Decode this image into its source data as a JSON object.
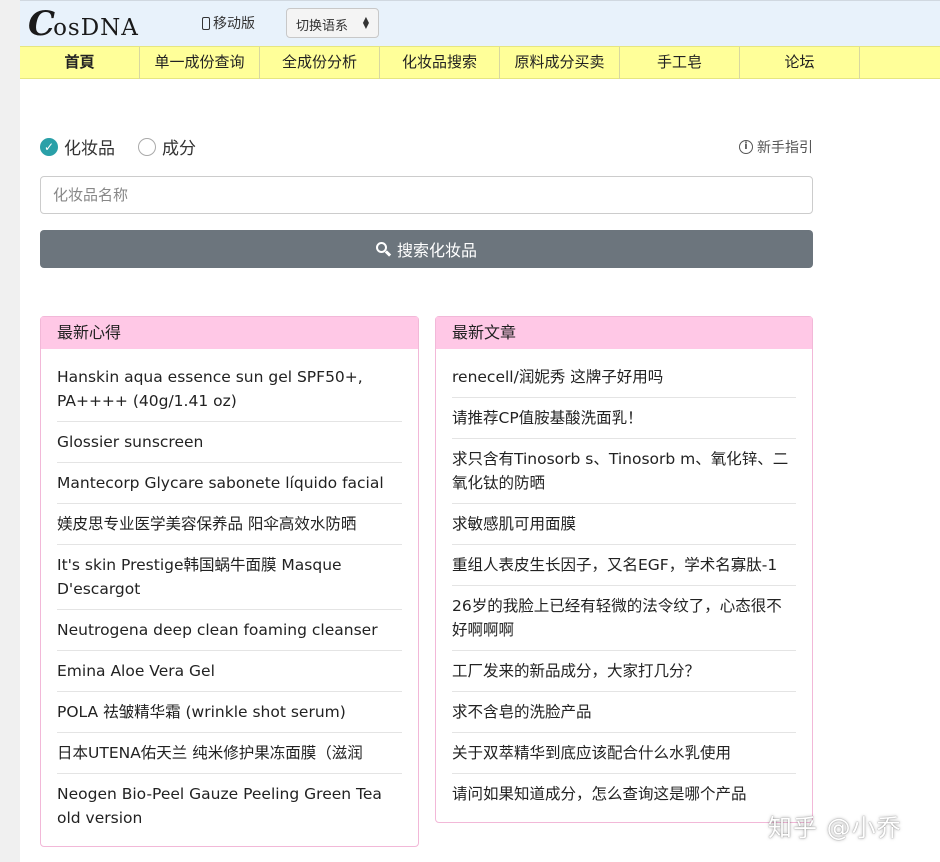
{
  "header": {
    "logo_initial": "C",
    "logo_rest": "osDNA",
    "mobile_label": "移动版",
    "language_select": "切换语系"
  },
  "nav": {
    "items": [
      "首頁",
      "单一成份查询",
      "全成份分析",
      "化妆品搜索",
      "原料成分买卖",
      "手工皂",
      "论坛"
    ]
  },
  "search": {
    "options": [
      {
        "label": "化妆品",
        "checked": true
      },
      {
        "label": "成分",
        "checked": false
      }
    ],
    "guide_label": "新手指引",
    "placeholder": "化妆品名称",
    "value": "",
    "button_label": "搜索化妆品"
  },
  "latest_reviews": {
    "title": "最新心得",
    "items": [
      "Hanskin aqua essence sun gel SPF50+, PA++++ (40g/1.41 oz)",
      "Glossier sunscreen",
      "Mantecorp Glycare sabonete líquido facial",
      "媄皮思专业医学美容保养品 阳伞高效水防晒",
      "It's skin Prestige韩国蜗牛面膜 Masque D'escargot",
      "Neutrogena deep clean foaming cleanser",
      "Emina Aloe Vera Gel",
      "POLA 祛皱精华霜 (wrinkle shot serum)",
      "日本UTENA佑天兰 纯米修护果冻面膜（滋润",
      "Neogen Bio-Peel Gauze Peeling Green Tea old version"
    ]
  },
  "latest_articles": {
    "title": "最新文章",
    "items": [
      "renecell/润妮秀 这牌子好用吗",
      "请推荐CP值胺基酸洗面乳！",
      "求只含有Tinosorb s、Tinosorb m、氧化锌、二氧化钛的防晒",
      "求敏感肌可用面膜",
      "重组人表皮生长因子，又名EGF，学术名寡肽-1",
      "26岁的我脸上已经有轻微的法令纹了，心态很不好啊啊啊",
      "工厂发来的新品成分，大家打几分？",
      "求不含皂的洗脸产品",
      "关于双萃精华到底应该配合什么水乳使用",
      "请问如果知道成分，怎么查询这是哪个产品"
    ]
  },
  "watermark": "知乎 @小乔",
  "colors": {
    "topbar": "#e8f2fb",
    "navbar": "#ffff99",
    "card_header": "#ffc8e6",
    "button": "#6c757d",
    "radio_checked": "#2aa0a8"
  }
}
